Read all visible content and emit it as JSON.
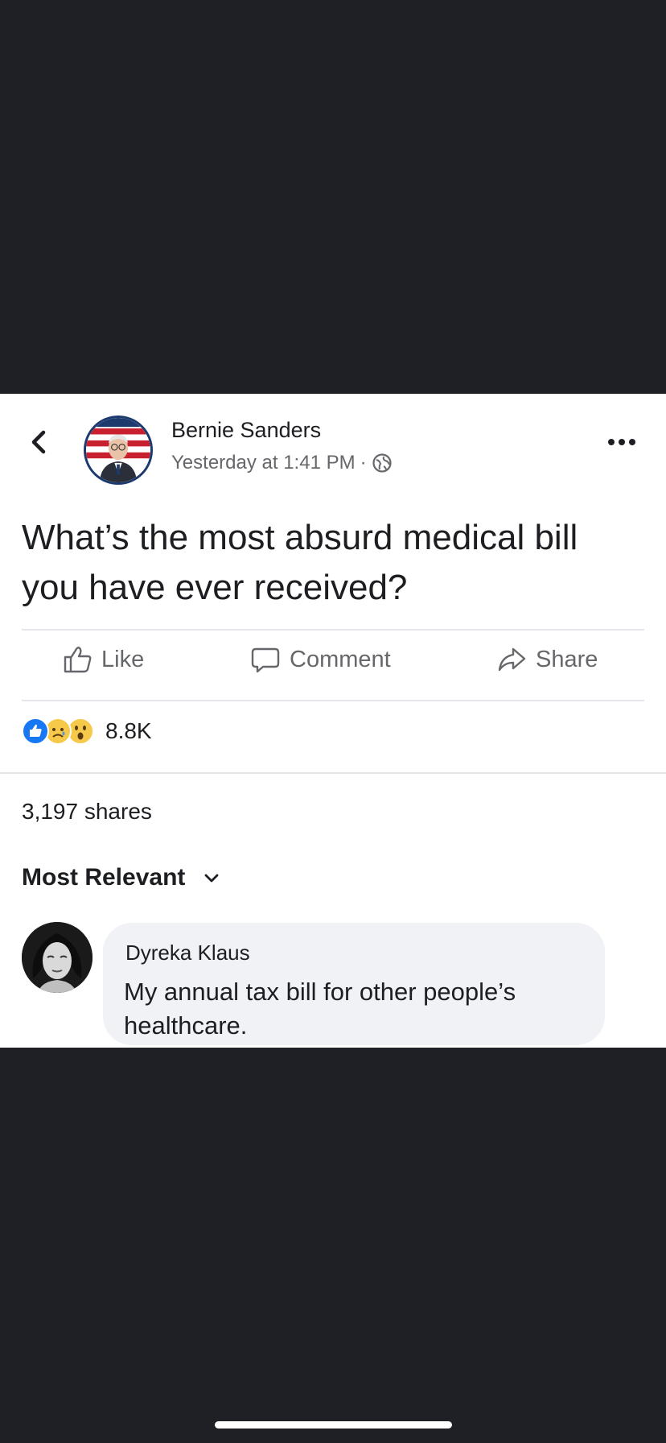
{
  "post": {
    "author": "Bernie Sanders",
    "timestamp": "Yesterday at 1:41 PM",
    "separator": "·",
    "privacy_icon": "globe-icon",
    "text": "What’s the most absurd medical bill you have ever received?"
  },
  "actions": {
    "like_label": "Like",
    "comment_label": "Comment",
    "share_label": "Share"
  },
  "reactions": {
    "icons": [
      "like-icon",
      "sad-icon",
      "wow-icon"
    ],
    "count": "8.8K"
  },
  "shares": "3,197 shares",
  "sort": {
    "label": "Most Relevant"
  },
  "comment": {
    "author": "Dyreka Klaus",
    "text": "My annual tax bill for other people’s healthcare."
  },
  "colors": {
    "background": "#1f2025",
    "card": "#ffffff",
    "secondary_text": "#65676b",
    "bubble": "#f0f2f5",
    "like_blue": "#1877f2",
    "emoji_yellow": "#f7c94a"
  }
}
